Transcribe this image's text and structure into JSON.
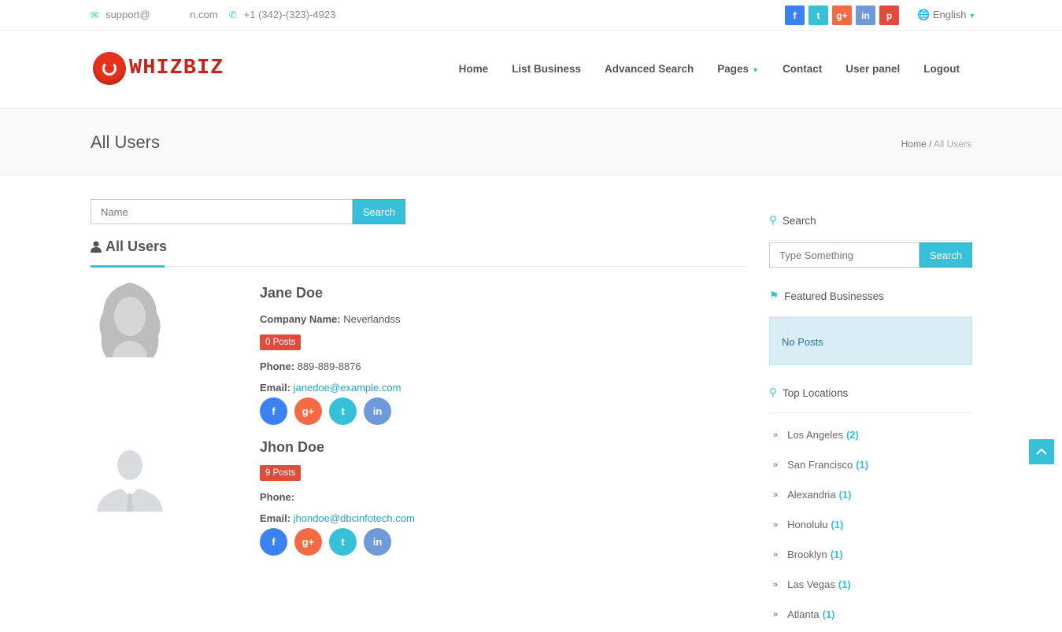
{
  "topbar": {
    "email": "support@              n.com",
    "phone": "+1 (342)-(323)-4923",
    "social": [
      {
        "icon": "facebook-icon",
        "glyph": "f",
        "color": "#3b82f0"
      },
      {
        "icon": "twitter-icon",
        "glyph": "t",
        "color": "#37c1d9"
      },
      {
        "icon": "google-plus-icon",
        "glyph": "g+",
        "color": "#f26b44"
      },
      {
        "icon": "linkedin-icon",
        "glyph": "in",
        "color": "#6f99d8"
      },
      {
        "icon": "pinterest-icon",
        "glyph": "p",
        "color": "#e14b3b"
      }
    ],
    "language": "English"
  },
  "header": {
    "logo_text": "WHIZBIZ",
    "nav": [
      "Home",
      "List Business",
      "Advanced Search",
      "Pages",
      "Contact",
      "User panel",
      "Logout"
    ]
  },
  "band": {
    "title": "All Users",
    "breadcrumb_home": "Home",
    "breadcrumb_sep": " / ",
    "breadcrumb_current": "All Users"
  },
  "main": {
    "search_placeholder": "Name",
    "search_button": "Search",
    "section_title": "All Users",
    "users": [
      {
        "name": "Jane Doe",
        "company_label": "Company Name:",
        "company": "Neverlandss",
        "posts": "0 Posts",
        "phone_label": "Phone:",
        "phone": "889-889-8876",
        "email_label": "Email:",
        "email": "janedoe@example.com"
      },
      {
        "name": "Jhon Doe",
        "posts": "9 Posts",
        "phone_label": "Phone:",
        "phone": "",
        "email_label": "Email:",
        "email": "jhondoe@dbcinfotech.com"
      }
    ],
    "user_social": [
      {
        "icon": "facebook-icon",
        "glyph": "f",
        "color": "#3b82f0"
      },
      {
        "icon": "google-plus-icon",
        "glyph": "g+",
        "color": "#f26b44"
      },
      {
        "icon": "twitter-icon",
        "glyph": "t",
        "color": "#37c1d9"
      },
      {
        "icon": "linkedin-icon",
        "glyph": "in",
        "color": "#6f99d8"
      }
    ]
  },
  "sidebar": {
    "search_title": "Search",
    "search_placeholder": "Type Something",
    "search_button": "Search",
    "featured_title": "Featured Businesses",
    "featured_empty": "No Posts",
    "locations_title": "Top Locations",
    "locations": [
      {
        "name": "Los Angeles",
        "count": "(2)"
      },
      {
        "name": "San Francisco",
        "count": "(1)"
      },
      {
        "name": "Alexandria",
        "count": "(1)"
      },
      {
        "name": "Honolulu",
        "count": "(1)"
      },
      {
        "name": "Brooklyn",
        "count": "(1)"
      },
      {
        "name": "Las Vegas",
        "count": "(1)"
      },
      {
        "name": "Atlanta",
        "count": "(1)"
      }
    ]
  },
  "colors": {
    "accent": "#37c1d9",
    "badge": "#e14b3b",
    "logo": "#c8231a"
  }
}
